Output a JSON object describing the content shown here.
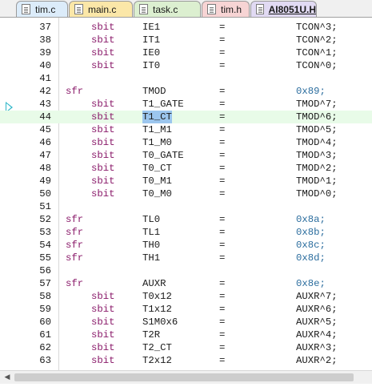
{
  "tabs": [
    {
      "label": "tim.c",
      "color": "#dcecfa",
      "active": false
    },
    {
      "label": "main.c",
      "color": "#fbe7a8",
      "active": false
    },
    {
      "label": "task.c",
      "color": "#dcefd0",
      "active": false
    },
    {
      "label": "tim.h",
      "color": "#f7d4d4",
      "active": false
    },
    {
      "label": "AI8051U.H",
      "color": "#e1daf3",
      "active": true
    }
  ],
  "editor": {
    "lines": [
      {
        "num": "37",
        "kw": "sbit",
        "name": "IE1",
        "op": "=",
        "value": "TCON^3;"
      },
      {
        "num": "38",
        "kw": "sbit",
        "name": "IT1",
        "op": "=",
        "value": "TCON^2;"
      },
      {
        "num": "39",
        "kw": "sbit",
        "name": "IE0",
        "op": "=",
        "value": "TCON^1;"
      },
      {
        "num": "40",
        "kw": "sbit",
        "name": "IT0",
        "op": "=",
        "value": "TCON^0;"
      },
      {
        "num": "41",
        "kw": "",
        "name": "",
        "op": "",
        "value": ""
      },
      {
        "num": "42",
        "kw": "sfr",
        "name": "TMOD",
        "op": "=",
        "value": "0x89;"
      },
      {
        "num": "43",
        "kw": "sbit",
        "name": "T1_GATE",
        "op": "=",
        "value": "TMOD^7;"
      },
      {
        "num": "44",
        "kw": "sbit",
        "name": "T1_CT",
        "op": "=",
        "value": "TMOD^6;",
        "highlight": true,
        "selected": true
      },
      {
        "num": "45",
        "kw": "sbit",
        "name": "T1_M1",
        "op": "=",
        "value": "TMOD^5;"
      },
      {
        "num": "46",
        "kw": "sbit",
        "name": "T1_M0",
        "op": "=",
        "value": "TMOD^4;"
      },
      {
        "num": "47",
        "kw": "sbit",
        "name": "T0_GATE",
        "op": "=",
        "value": "TMOD^3;"
      },
      {
        "num": "48",
        "kw": "sbit",
        "name": "T0_CT",
        "op": "=",
        "value": "TMOD^2;"
      },
      {
        "num": "49",
        "kw": "sbit",
        "name": "T0_M1",
        "op": "=",
        "value": "TMOD^1;"
      },
      {
        "num": "50",
        "kw": "sbit",
        "name": "T0_M0",
        "op": "=",
        "value": "TMOD^0;"
      },
      {
        "num": "51",
        "kw": "",
        "name": "",
        "op": "",
        "value": ""
      },
      {
        "num": "52",
        "kw": "sfr",
        "name": "TL0",
        "op": "=",
        "value": "0x8a;"
      },
      {
        "num": "53",
        "kw": "sfr",
        "name": "TL1",
        "op": "=",
        "value": "0x8b;"
      },
      {
        "num": "54",
        "kw": "sfr",
        "name": "TH0",
        "op": "=",
        "value": "0x8c;"
      },
      {
        "num": "55",
        "kw": "sfr",
        "name": "TH1",
        "op": "=",
        "value": "0x8d;"
      },
      {
        "num": "56",
        "kw": "",
        "name": "",
        "op": "",
        "value": ""
      },
      {
        "num": "57",
        "kw": "sfr",
        "name": "AUXR",
        "op": "=",
        "value": "0x8e;"
      },
      {
        "num": "58",
        "kw": "sbit",
        "name": "T0x12",
        "op": "=",
        "value": "AUXR^7;"
      },
      {
        "num": "59",
        "kw": "sbit",
        "name": "T1x12",
        "op": "=",
        "value": "AUXR^6;"
      },
      {
        "num": "60",
        "kw": "sbit",
        "name": "S1M0x6",
        "op": "=",
        "value": "AUXR^5;"
      },
      {
        "num": "61",
        "kw": "sbit",
        "name": "T2R",
        "op": "=",
        "value": "AUXR^4;"
      },
      {
        "num": "62",
        "kw": "sbit",
        "name": "T2_CT",
        "op": "=",
        "value": "AUXR^3;"
      },
      {
        "num": "63",
        "kw": "sbit",
        "name": "T2x12",
        "op": "=",
        "value": "AUXR^2;"
      }
    ]
  },
  "scrollbar": {
    "left_icon": "arrow-left-icon",
    "right_icon": "arrow-right-icon",
    "left_glyph": "◀",
    "right_glyph": "▶"
  },
  "colors": {
    "keyword": "#8a1a6a",
    "hex_value": "#2b6d9e",
    "current_line": "#e8fbe8",
    "selection": "#9cc6ee",
    "marker": "#2db6c8"
  }
}
